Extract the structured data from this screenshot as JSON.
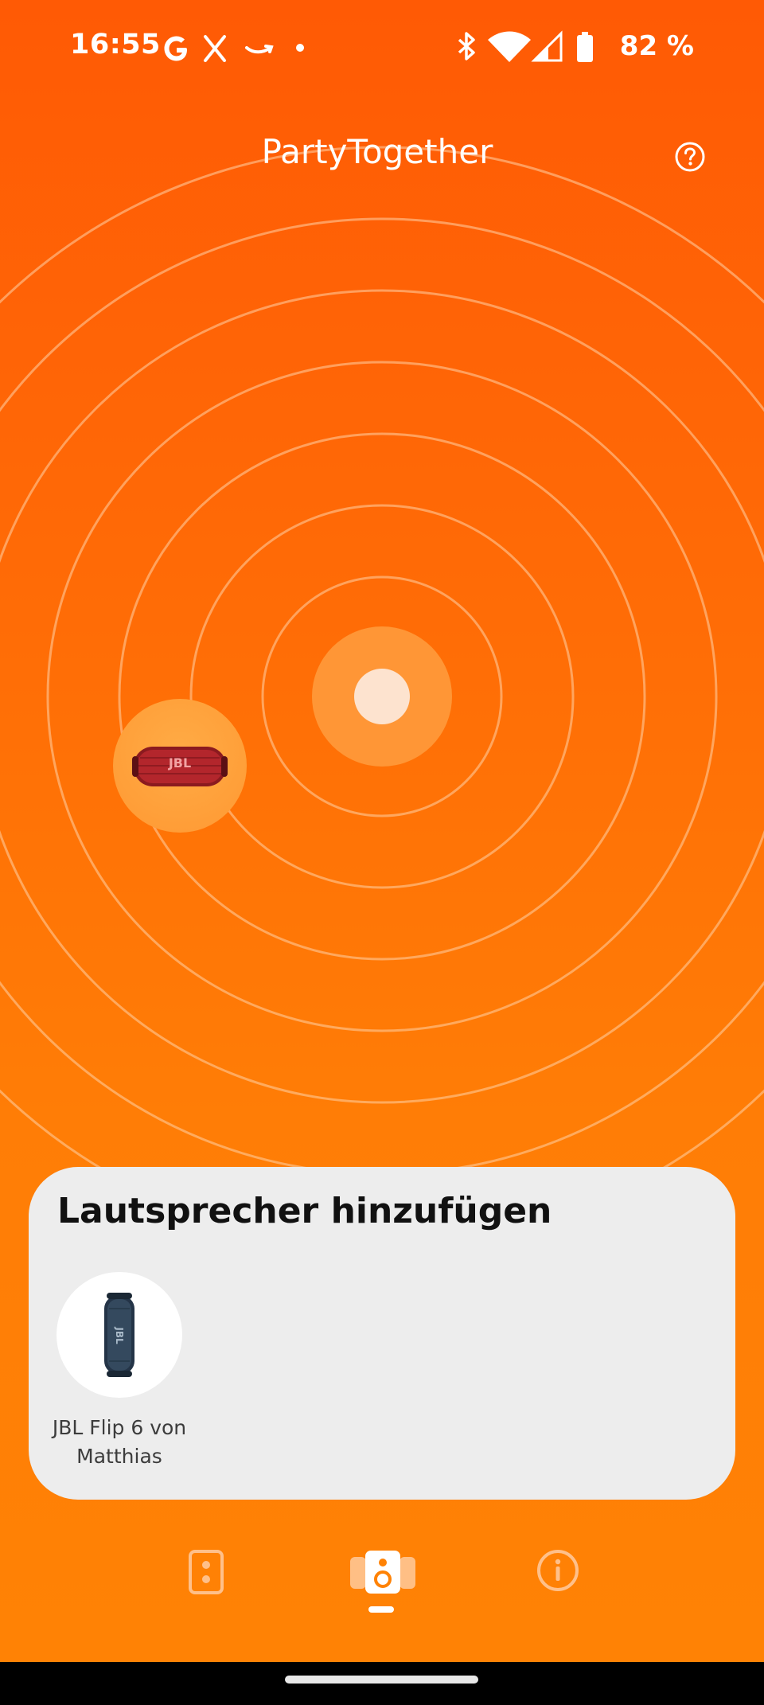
{
  "status_bar": {
    "time": "16:55",
    "battery": "82 %",
    "left_icons": [
      "google-icon",
      "x-icon",
      "amazon-icon",
      "dot-icon"
    ],
    "right_icons": [
      "bluetooth-icon",
      "wifi-icon",
      "signal-icon",
      "battery-icon"
    ]
  },
  "header": {
    "title": "PartyTogether",
    "help_icon": "question-circle-icon"
  },
  "radar": {
    "connected_speaker_icon": "jbl-charge-speaker-icon",
    "accent_color": "#ff6a06"
  },
  "panel": {
    "title": "Lautsprecher hinzufügen",
    "devices": [
      {
        "label": "JBL Flip 6 von Matthias",
        "icon": "jbl-flip-speaker-icon"
      }
    ]
  },
  "bottom_nav": {
    "items": [
      {
        "icon": "speaker-icon",
        "selected": false
      },
      {
        "icon": "multi-speaker-icon",
        "selected": true
      },
      {
        "icon": "info-icon",
        "selected": false
      }
    ]
  }
}
